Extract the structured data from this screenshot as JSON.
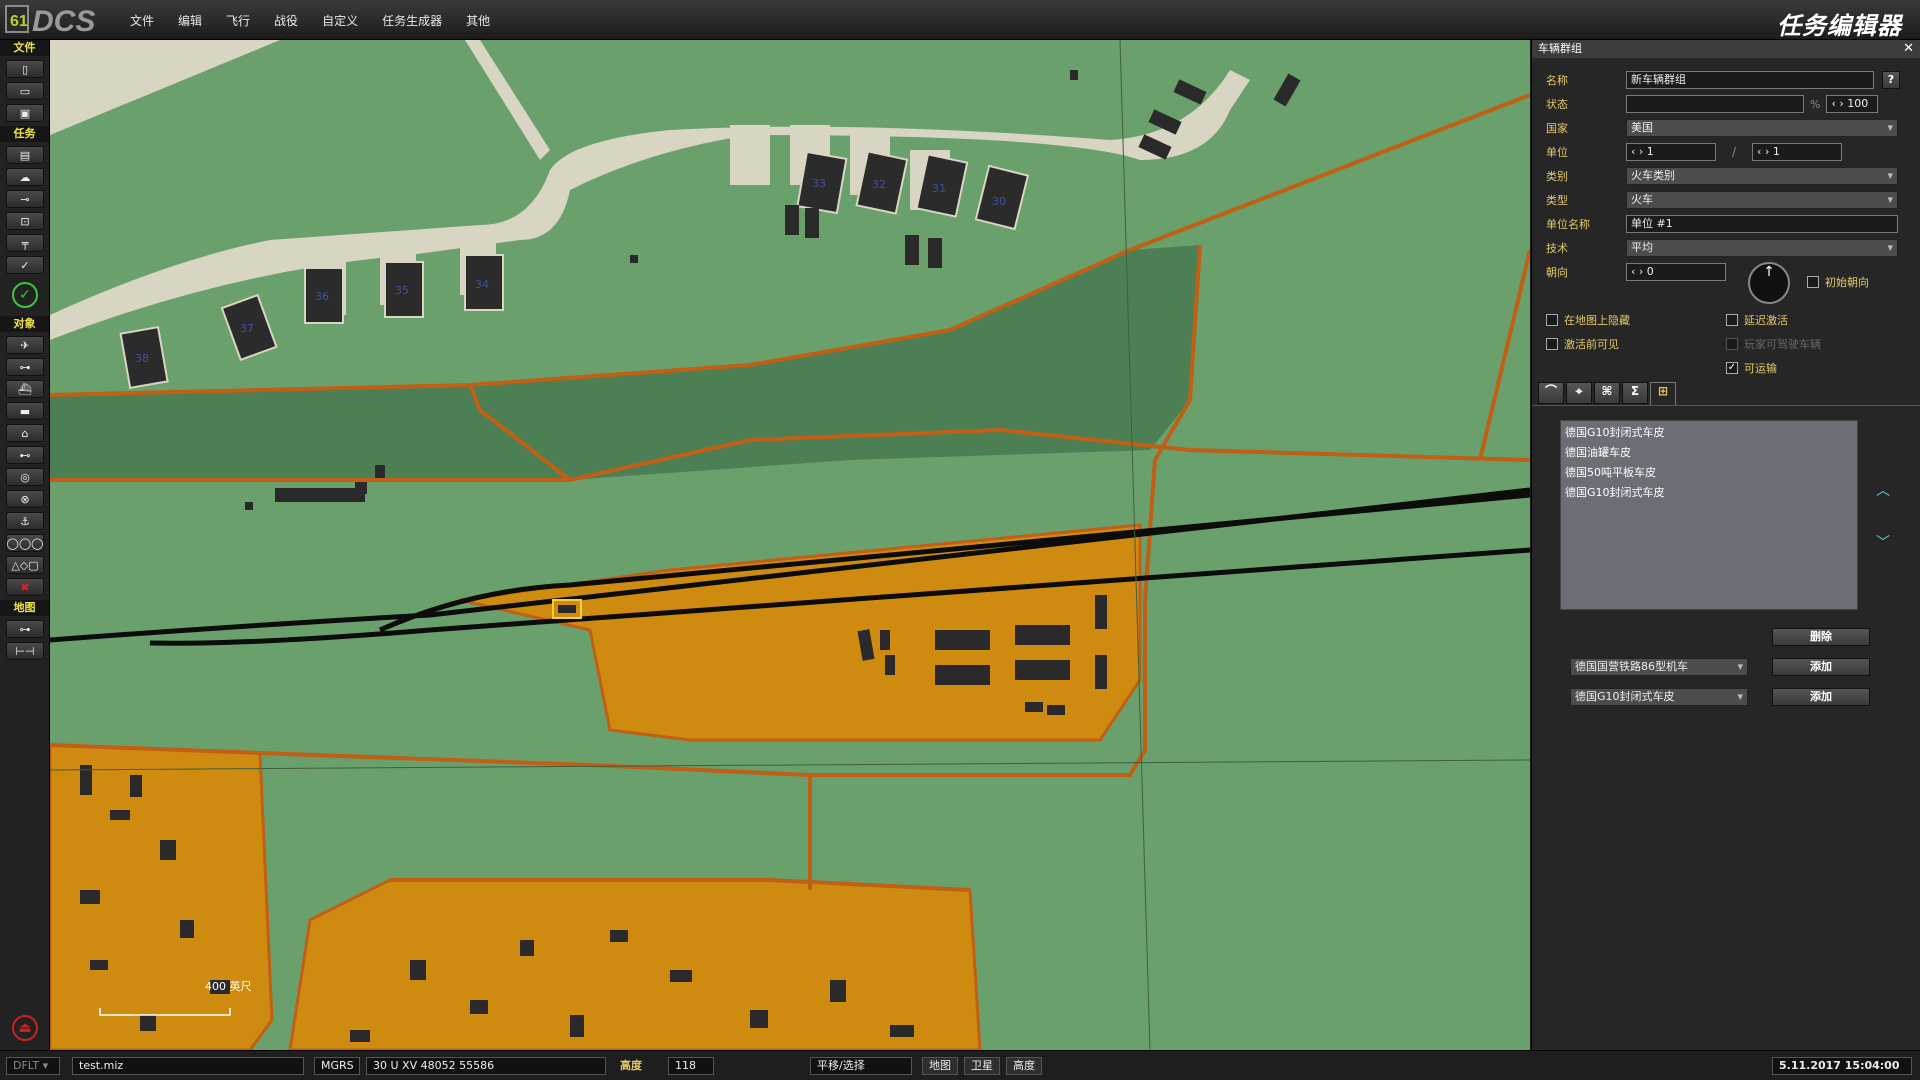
{
  "app": {
    "logo_text": "DCS",
    "title": "任务编辑器",
    "menu": [
      "文件",
      "编辑",
      "飞行",
      "战役",
      "自定义",
      "任务生成器",
      "其他"
    ]
  },
  "toolbar": {
    "sections": {
      "file": "文件",
      "mission": "任务",
      "objects": "对象",
      "map": "地图"
    }
  },
  "panel": {
    "title": "车辆群组",
    "help": "?",
    "labels": {
      "name": "名称",
      "condition": "状态",
      "country": "国家",
      "unit": "单位",
      "category": "类别",
      "type": "类型",
      "unit_name": "单位名称",
      "skill": "技术",
      "heading": "朝向"
    },
    "values": {
      "name": "新车辆群组",
      "condition": "",
      "condition_pct": "100",
      "percent": "%",
      "country": "美国",
      "unit_cur": "1",
      "unit_sep": "/",
      "unit_total": "1",
      "category": "火车类别",
      "type": "火车",
      "unit_name": "单位 #1",
      "skill": "平均",
      "heading": "0"
    },
    "checkboxes": {
      "initial_heading": "初始朝向",
      "hide_on_map": "在地图上隐藏",
      "late_activation": "延迟激活",
      "visible_before_start": "激活前可见",
      "player_can_drive": "玩家可驾驶车辆",
      "transportable": "可运输"
    },
    "checked": {
      "transportable": "✓"
    },
    "wagons": [
      "德国G10封闭式车皮",
      "德国油罐车皮",
      "德国50吨平板车皮",
      "德国G10封闭式车皮"
    ],
    "delete_label": "删除",
    "loco_select": "德国国营铁路86型机车",
    "wagon_select": "德国G10封闭式车皮",
    "add_label": "添加",
    "scroll_up": "︿",
    "scroll_down": "﹀"
  },
  "status": {
    "profile": "DFLT",
    "file": "test.miz",
    "coord_sys": "MGRS",
    "coords": "30 U XV 48052 55586",
    "alt_label": "高度",
    "alt": "118",
    "mode": "平移/选择",
    "map_btn": "地图",
    "sat_btn": "卫星",
    "alt_btn": "高度",
    "datetime": "5.11.2017 15:04:00"
  },
  "map": {
    "scale_label": "400 英尺",
    "building_numbers": [
      "33",
      "32",
      "31",
      "30",
      "38",
      "37",
      "36",
      "35",
      "34"
    ]
  },
  "colors": {
    "map_green": "#6aa06c",
    "urban": "#cf8a10",
    "road": "#c15f14",
    "forest": "#4d7f55",
    "panel_bg": "#262626",
    "label_yellow": "#e6c868"
  }
}
